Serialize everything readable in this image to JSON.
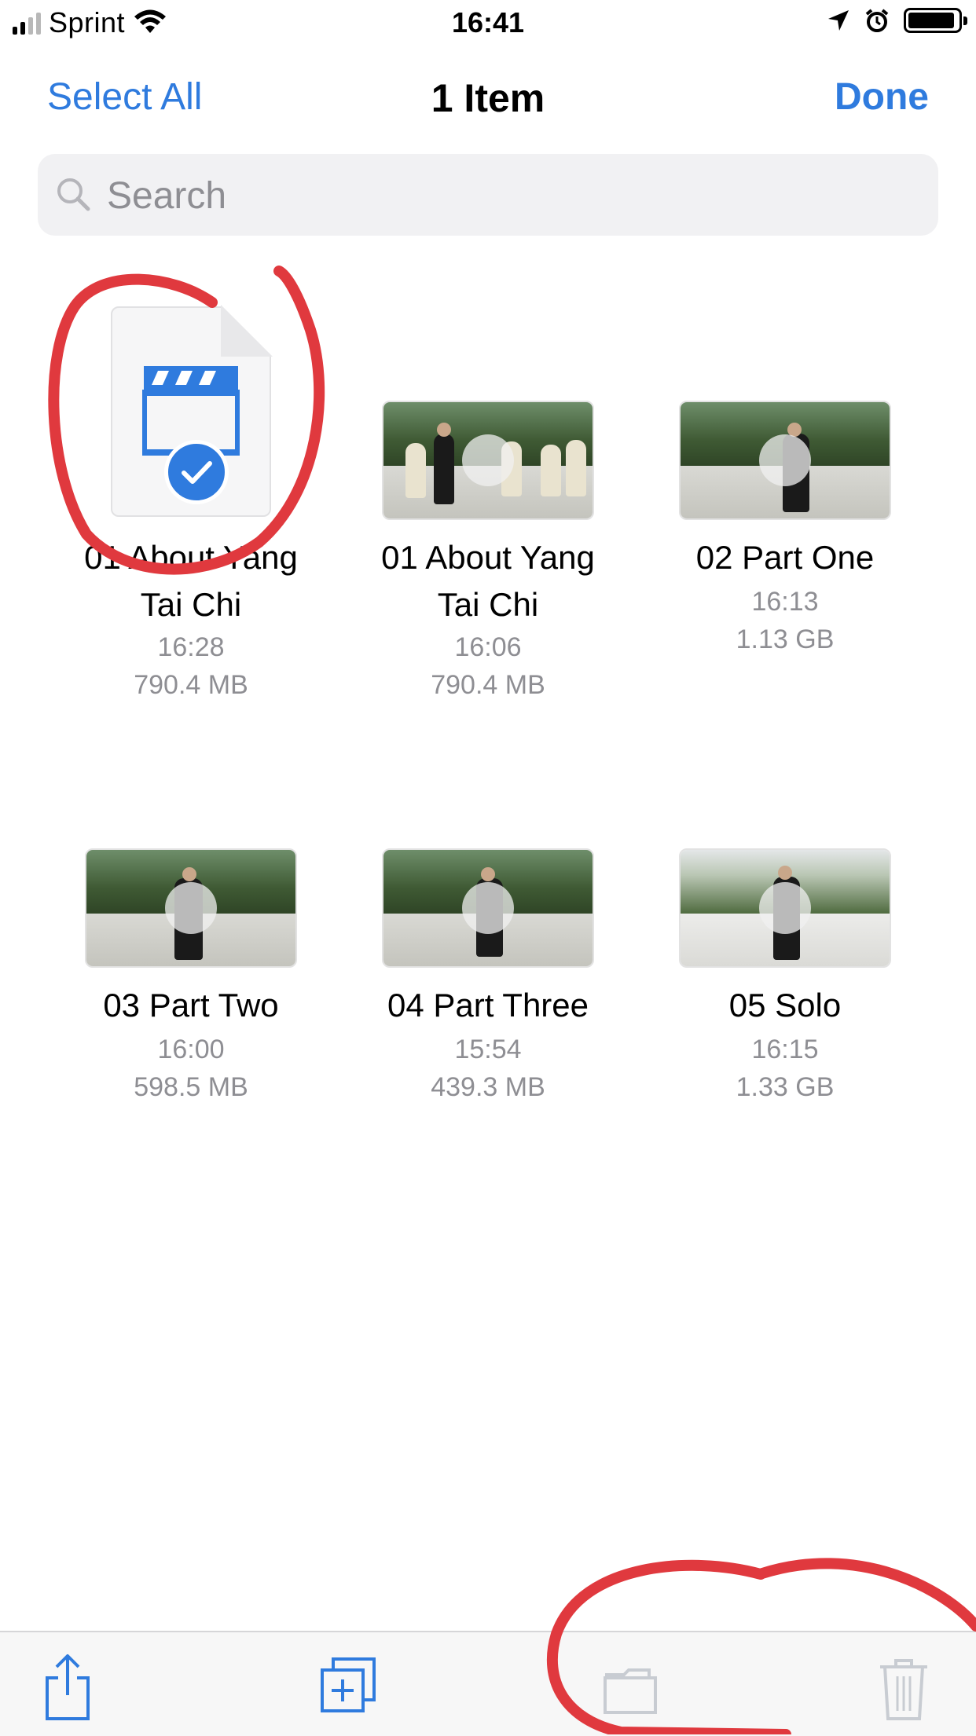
{
  "status_bar": {
    "carrier": "Sprint",
    "time": "16:41",
    "signal_bars_filled": 2,
    "signal_bars_total": 4
  },
  "nav": {
    "left_label": "Select All",
    "title": "1 Item",
    "right_label": "Done"
  },
  "search": {
    "placeholder": "Search",
    "value": ""
  },
  "colors": {
    "accent": "#2f7bde",
    "annotation": "#e0393e"
  },
  "files": [
    {
      "name_line1": "01 About Yang",
      "name_line2": "Tai Chi",
      "time": "16:28",
      "size": "790.4 MB",
      "selected": true,
      "icon": "video-document-icon"
    },
    {
      "name_line1": "01 About Yang",
      "name_line2": "Tai Chi",
      "time": "16:06",
      "size": "790.4 MB",
      "selected": false,
      "icon": "video-thumbnail"
    },
    {
      "name_line1": "02 Part One",
      "name_line2": "",
      "time": "16:13",
      "size": "1.13 GB",
      "selected": false,
      "icon": "video-thumbnail"
    },
    {
      "name_line1": "03 Part Two",
      "name_line2": "",
      "time": "16:00",
      "size": "598.5 MB",
      "selected": false,
      "icon": "video-thumbnail"
    },
    {
      "name_line1": "04 Part Three",
      "name_line2": "",
      "time": "15:54",
      "size": "439.3 MB",
      "selected": false,
      "icon": "video-thumbnail"
    },
    {
      "name_line1": "05 Solo",
      "name_line2": "",
      "time": "16:15",
      "size": "1.33 GB",
      "selected": false,
      "icon": "video-thumbnail"
    }
  ],
  "toolbar": {
    "items": [
      {
        "icon": "share-icon",
        "enabled": true
      },
      {
        "icon": "duplicate-icon",
        "enabled": true
      },
      {
        "icon": "move-folder-icon",
        "enabled": false
      },
      {
        "icon": "trash-icon",
        "enabled": false
      }
    ]
  }
}
